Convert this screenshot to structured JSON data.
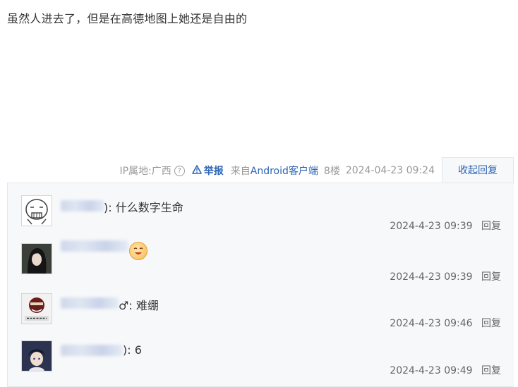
{
  "post": {
    "text": "虽然人进去了，但是在高德地图上她还是自由的"
  },
  "meta": {
    "ip": "IP属地:广西",
    "help_icon": "?",
    "report_label": "举报",
    "source_prefix": "来自",
    "source_client": "Android客户端",
    "floor": "8楼",
    "timestamp": "2024-04-23 09:24",
    "collapse_label": "收起回复"
  },
  "replies": [
    {
      "avatar_icon": "meme-face-avatar",
      "text_suffix": "): 什么数字生命",
      "time": "2024-4-23 09:39",
      "reply_label": "回复"
    },
    {
      "avatar_icon": "dark-hair-avatar",
      "text_suffix": "",
      "sticker_icon": "laughing-emoji-sticker",
      "time": "2024-4-23 09:39",
      "reply_label": "回复"
    },
    {
      "avatar_icon": "red-meme-avatar",
      "text_suffix": "♂: 难绷",
      "time": "2024-4-23 09:46",
      "reply_label": "回复"
    },
    {
      "avatar_icon": "anime-boy-avatar",
      "text_suffix": "): 6",
      "time": "2024-4-23 09:49",
      "reply_label": "回复"
    }
  ],
  "colors": {
    "link": "#2d64b3",
    "meta_gray": "#999999",
    "reply_bg": "#f7f8fa"
  }
}
